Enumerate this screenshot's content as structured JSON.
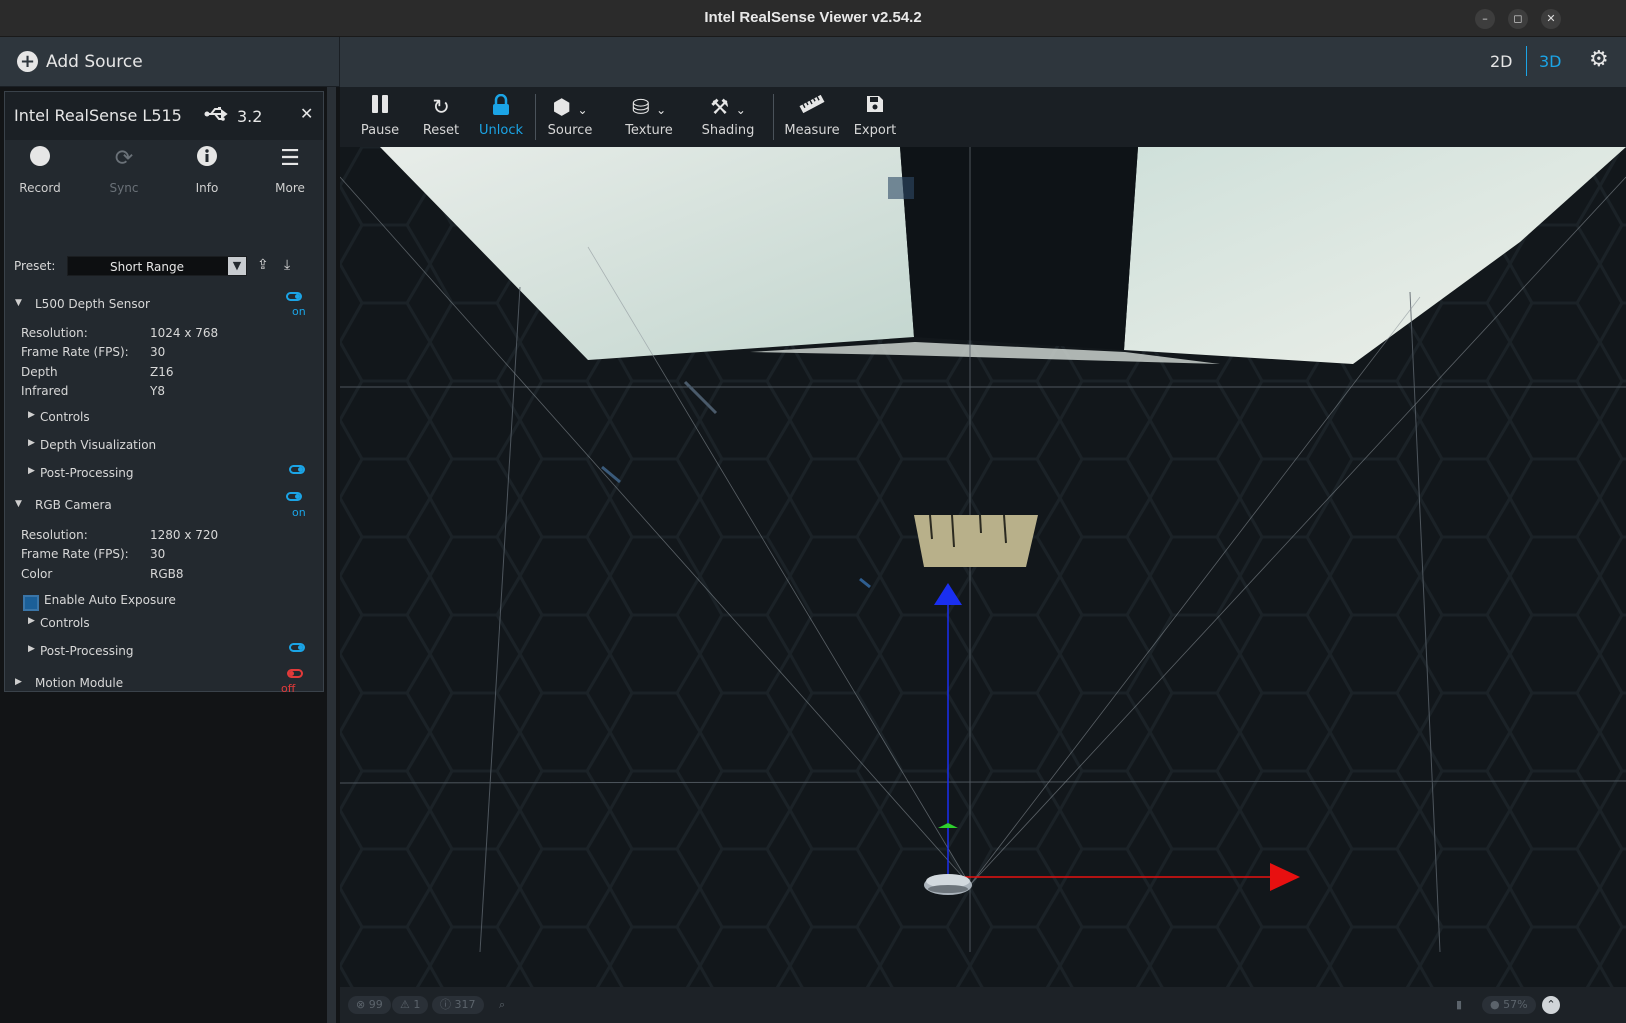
{
  "window": {
    "title": "Intel RealSense Viewer v2.54.2",
    "minimize": "–",
    "restore": "◻",
    "close": "✕"
  },
  "sidebar": {
    "add_source_label": "Add Source",
    "device": {
      "name": "Intel RealSense L515",
      "usb_icon": "usb-icon",
      "usb_version": "3.2",
      "close": "✕",
      "buttons": [
        {
          "label": "Record",
          "icon": "record-icon"
        },
        {
          "label": "Sync",
          "icon": "sync-icon"
        },
        {
          "label": "Info",
          "icon": "info-icon"
        },
        {
          "label": "More",
          "icon": "menu-icon"
        }
      ],
      "preset_label": "Preset:",
      "preset_value": "Short Range",
      "sensors": [
        {
          "name": "L500 Depth Sensor",
          "state": "on",
          "props": [
            {
              "label": "Resolution:",
              "value": "1024 x 768"
            },
            {
              "label": "Frame Rate (FPS):",
              "value": "30"
            },
            {
              "label": "Depth",
              "value": "Z16"
            },
            {
              "label": "Infrared",
              "value": "Y8"
            }
          ],
          "sections": [
            "Controls",
            "Depth Visualization",
            "Post-Processing"
          ]
        },
        {
          "name": "RGB Camera",
          "state": "on",
          "props": [
            {
              "label": "Resolution:",
              "value": "1280 x 720"
            },
            {
              "label": "Frame Rate (FPS):",
              "value": "30"
            },
            {
              "label": "Color",
              "value": "RGB8"
            }
          ],
          "checkbox_label": "Enable Auto Exposure",
          "sections": [
            "Controls",
            "Post-Processing"
          ]
        },
        {
          "name": "Motion Module",
          "state": "off"
        }
      ]
    }
  },
  "topbar": {
    "view_2d": "2D",
    "view_3d": "3D",
    "settings_icon": "gear-icon"
  },
  "toolbar": [
    {
      "label": "Pause",
      "icon": "pause-icon"
    },
    {
      "label": "Reset",
      "icon": "reset-icon"
    },
    {
      "label": "Unlock",
      "icon": "lock-icon"
    },
    {
      "label": "Source",
      "icon": "cube-icon"
    },
    {
      "label": "Texture",
      "icon": "paint-bucket-icon"
    },
    {
      "label": "Shading",
      "icon": "paint-roller-icon"
    },
    {
      "label": "Measure",
      "icon": "ruler-icon"
    },
    {
      "label": "Export",
      "icon": "save-icon"
    }
  ],
  "statusbar": {
    "errors": "99",
    "warnings": "1",
    "info": "317",
    "battery": "57%"
  },
  "colors": {
    "accent": "#1ba4e6",
    "off": "#e23a3a",
    "panel": "#23292f",
    "bar": "#2e363d"
  }
}
